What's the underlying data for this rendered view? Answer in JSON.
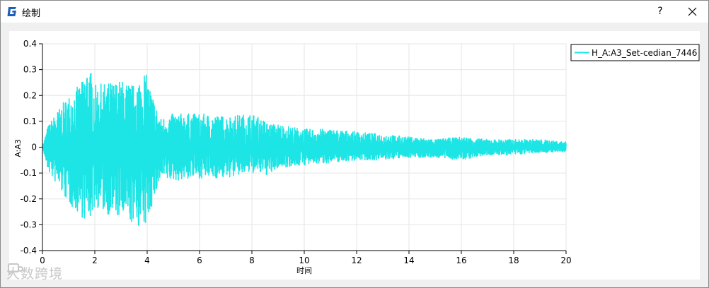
{
  "window": {
    "title": "绘制",
    "help_label": "?"
  },
  "icons": {
    "app": "app-logo-icon",
    "close": "close-icon",
    "watermark": "chat-bubble-icon"
  },
  "watermark_text": "大数跨境",
  "colors": {
    "series": "#1de5e5",
    "grid": "#e6e6e6",
    "titlebar": "#ffffff",
    "panel": "#ffffff",
    "background": "#f0f0f0"
  },
  "chart_data": {
    "type": "line",
    "title": "",
    "xlabel": "时间",
    "ylabel": "A:A3",
    "xlim": [
      0,
      20
    ],
    "ylim": [
      -0.4,
      0.4
    ],
    "x_ticks": [
      "0",
      "2",
      "4",
      "6",
      "8",
      "10",
      "12",
      "14",
      "16",
      "18",
      "20"
    ],
    "y_ticks": [
      "0.4",
      "0.3",
      "0.2",
      "0.1",
      "0",
      "-0.1",
      "-0.2",
      "-0.3",
      "-0.4"
    ],
    "grid": true,
    "legend_position": "top-right",
    "series": [
      {
        "name": "H_A:A3_Set-cedian_7446",
        "envelope": {
          "t": [
            0,
            0.2,
            0.5,
            1.0,
            1.5,
            1.75,
            2.0,
            2.5,
            3.0,
            3.5,
            3.9,
            4.5,
            5.0,
            6.0,
            7.0,
            8.0,
            8.7,
            9.0,
            10.0,
            11.0,
            12.0,
            13.0,
            14.0,
            15.0,
            16.0,
            17.0,
            18.0,
            19.0,
            20.0
          ],
          "upper": [
            0.0,
            0.08,
            0.13,
            0.2,
            0.25,
            0.33,
            0.24,
            0.25,
            0.26,
            0.24,
            0.3,
            0.11,
            0.13,
            0.13,
            0.12,
            0.13,
            0.09,
            0.09,
            0.07,
            0.07,
            0.06,
            0.05,
            0.04,
            0.03,
            0.04,
            0.03,
            0.03,
            0.03,
            0.02
          ],
          "lower": [
            0.0,
            -0.09,
            -0.14,
            -0.22,
            -0.27,
            -0.3,
            -0.23,
            -0.26,
            -0.28,
            -0.3,
            -0.32,
            -0.13,
            -0.13,
            -0.12,
            -0.12,
            -0.1,
            -0.11,
            -0.08,
            -0.07,
            -0.06,
            -0.05,
            -0.05,
            -0.04,
            -0.04,
            -0.05,
            -0.03,
            -0.03,
            -0.02,
            -0.02
          ]
        }
      }
    ]
  }
}
